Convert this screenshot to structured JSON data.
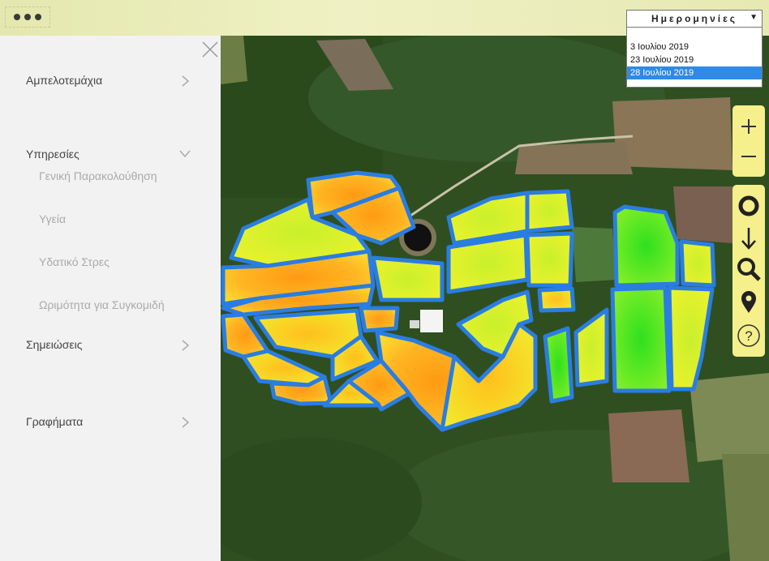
{
  "menu": {
    "dots_label": "more-options",
    "dates": {
      "label": "Ημερομηνίες",
      "options": [
        "3 Ιουλίου 2019",
        "23 Ιουλίου 2019",
        "28 Ιουλίου 2019"
      ],
      "selected": "28 Ιουλίου 2019"
    }
  },
  "sidebar": {
    "items": [
      {
        "label": "Αμπελοτεμάχια"
      },
      {
        "label": "Υπηρεσίες"
      },
      {
        "label": "Σημειώσεις"
      },
      {
        "label": "Γραφήματα"
      }
    ],
    "services": [
      {
        "label": "Γενική Παρακολούθηση"
      },
      {
        "label": "Υγεία"
      },
      {
        "label": "Υδατικό Στρες"
      },
      {
        "label": "Ωριμότητα για Συγκομιδή"
      }
    ]
  },
  "map_controls": {
    "zoom_in": "+",
    "zoom_out": "−",
    "icons": [
      "circle-icon",
      "download-arrow-icon",
      "search-icon",
      "location-pin-icon",
      "help-icon"
    ]
  },
  "colors": {
    "field_border": "#2a7de1",
    "forest": "#2f4f20",
    "toolbar_bg": "#f5ef8c",
    "selection": "#2f89e6"
  }
}
